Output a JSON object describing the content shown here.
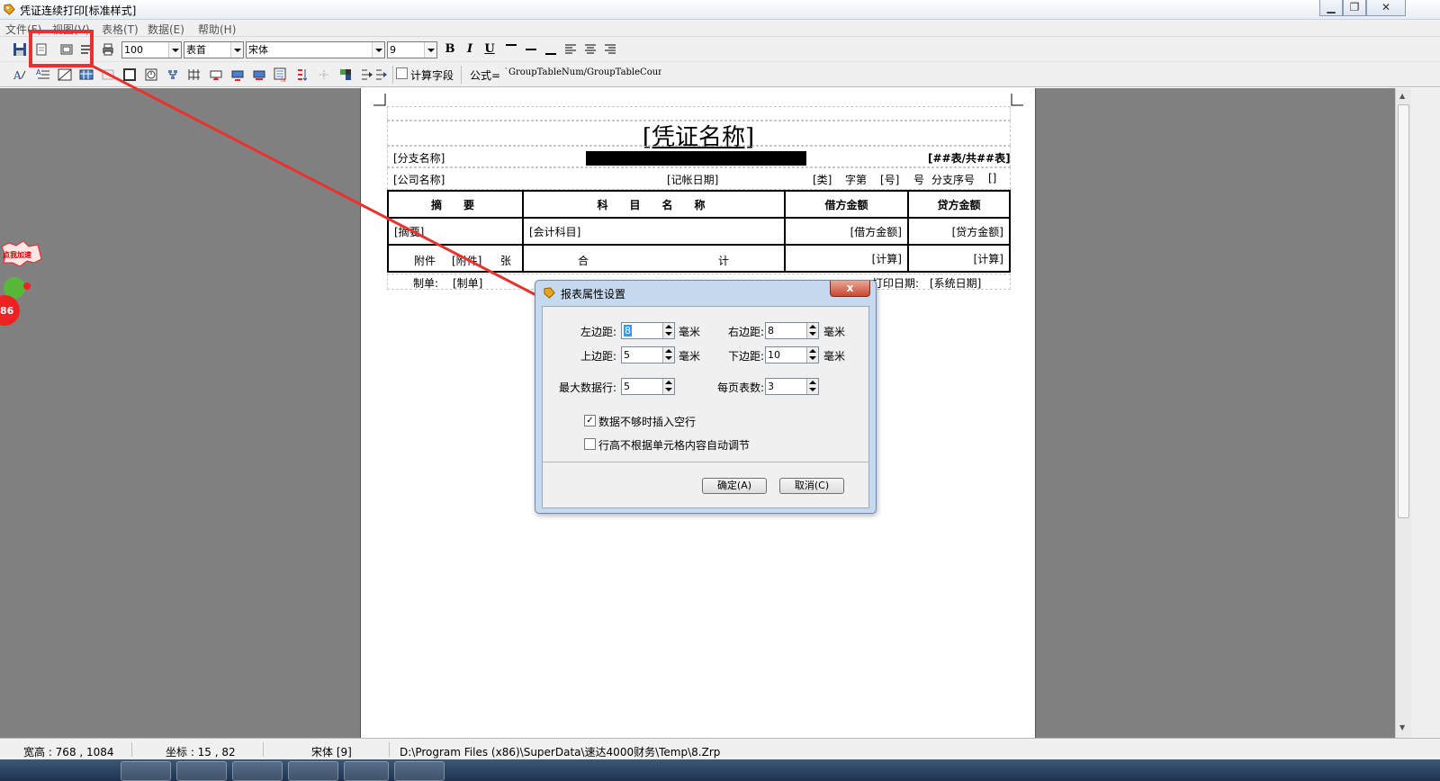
{
  "window": {
    "title": "凭证连续打印[标准样式]",
    "minimize": "▁",
    "restore": "❐",
    "close": "✕"
  },
  "menu": [
    "文件(F)",
    "视图(V)",
    "表格(T)",
    "数据(E)",
    "帮助(H)"
  ],
  "toolbar1": {
    "zoom": "100",
    "section": "表首",
    "font": "宋体",
    "font_size": "9",
    "bold": "B",
    "italic": "I",
    "underline": "U"
  },
  "toolbar2": {
    "calc_field_label": "计算字段",
    "calc_field_checked": false,
    "formula_label": "公式=",
    "formula_value": "`GroupTableNum/GroupTableCoun"
  },
  "report": {
    "title": "[凭证名称]",
    "branch_name": "[分支名称]",
    "table_count": "[##表/共##表]",
    "company_name": "[公司名称]",
    "post_date": "[记帐日期]",
    "type": "[类]",
    "zi_di": "字第",
    "number": "[号]",
    "hao": "号",
    "branch_seq": "分支序号",
    "empty_bracket": "[]",
    "headers": [
      "摘　要",
      "科　目　名　称",
      "借方金额",
      "贷方金额"
    ],
    "row1": [
      "[摘要]",
      "[会计科目]",
      "[借方金额]",
      "[贷方金额]"
    ],
    "attach_label": "附件",
    "attach_value": "[附件]",
    "zhang": "张",
    "total_he": "合",
    "total_ji": "计",
    "calc1": "[计算]",
    "calc2": "[计算]",
    "maker_label": "制单:",
    "maker_value": "[制单]",
    "print_date_label": "打印日期:",
    "print_date_value": "[系统日期]"
  },
  "float_widget": {
    "label": "点我加速",
    "count": "86"
  },
  "dialog": {
    "title": "报表属性设置",
    "left_margin_label": "左边距:",
    "left_margin_value": "8",
    "right_margin_label": "右边距:",
    "right_margin_value": "8",
    "top_margin_label": "上边距:",
    "top_margin_value": "5",
    "bottom_margin_label": "下边距:",
    "bottom_margin_value": "10",
    "unit": "毫米",
    "max_rows_label": "最大数据行:",
    "max_rows_value": "5",
    "tables_per_page_label": "每页表数:",
    "tables_per_page_value": "3",
    "insert_blank_label": "数据不够时插入空行",
    "insert_blank_checked": true,
    "auto_height_label": "行高不根据单元格内容自动调节",
    "auto_height_checked": false,
    "ok_label": "确定(A)",
    "cancel_label": "取消(C)",
    "close": "x"
  },
  "status": {
    "size": "宽高 : 768 , 1084",
    "coord": "坐标 : 15 , 82",
    "font": "宋体 [9]",
    "path": "D:\\Program Files (x86)\\SuperData\\速达4000财务\\Temp\\8.Zrp"
  },
  "colors": {
    "annotation": "#e8322d",
    "workspace": "#808080",
    "dialog_frame": "#c7d9ef"
  }
}
